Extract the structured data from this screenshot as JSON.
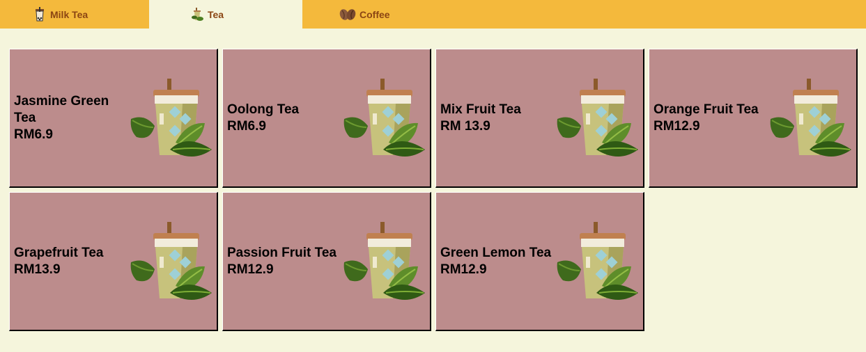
{
  "tabs": [
    {
      "label": "Milk Tea",
      "icon": "bubble-tea-icon",
      "active": false
    },
    {
      "label": "Tea",
      "icon": "tea-plant-icon",
      "active": true
    },
    {
      "label": "Coffee",
      "icon": "coffee-bean-icon",
      "active": false
    }
  ],
  "items": [
    {
      "name": "Jasmine Green Tea",
      "price": "RM6.9"
    },
    {
      "name": "Oolong Tea",
      "price": "RM6.9"
    },
    {
      "name": "Mix Fruit Tea",
      "price": "RM 13.9"
    },
    {
      "name": "Orange Fruit Tea",
      "price": "RM12.9"
    },
    {
      "name": "Grapefruit Tea",
      "price": "RM13.9"
    },
    {
      "name": "Passion Fruit Tea",
      "price": "RM12.9"
    },
    {
      "name": "Green Lemon Tea",
      "price": "RM12.9"
    }
  ],
  "colors": {
    "tab_bar": "#f4b93c",
    "active_tab": "#f5f5dc",
    "tab_text": "#8b4513",
    "card": "#bc8c8c",
    "page": "#f5f5dc"
  },
  "item_icon": "iced-tea-cup-icon"
}
